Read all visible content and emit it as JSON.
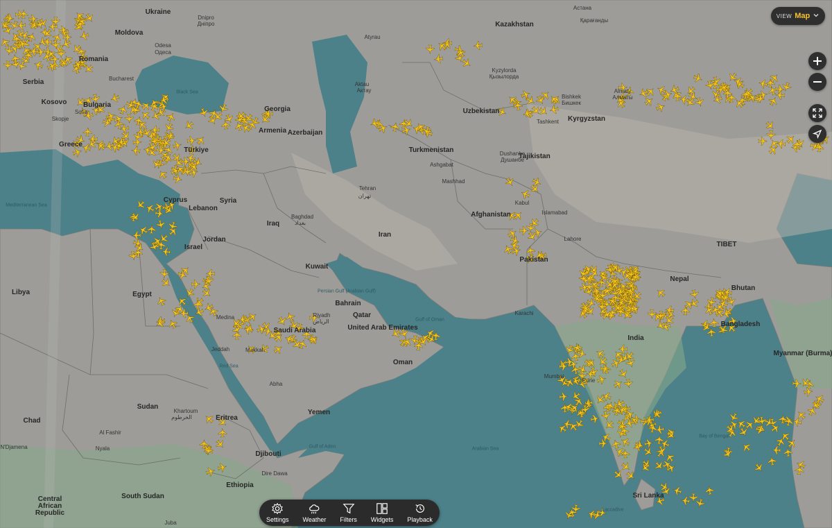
{
  "view": {
    "label": "VIEW",
    "mode": "Map"
  },
  "toolbar": [
    {
      "label": "Settings"
    },
    {
      "label": "Weather"
    },
    {
      "label": "Filters"
    },
    {
      "label": "Widgets"
    },
    {
      "label": "Playback"
    }
  ],
  "labels": {
    "countries": [
      "Ukraine",
      "Moldova",
      "Romania",
      "Serbia",
      "Bulgaria",
      "Kosovo",
      "Greece",
      "Georgia",
      "Armenia",
      "Azerbaijan",
      "Türkiye",
      "Cyprus",
      "Syria",
      "Lebanon",
      "Iraq",
      "Israel",
      "Jordan",
      "Libya",
      "Egypt",
      "Kuwait",
      "Iran",
      "Kazakhstan",
      "Uzbekistan",
      "Turkmenistan",
      "Tajikistan",
      "Kyrgyzstan",
      "Afghanistan",
      "Pakistan",
      "India",
      "Nepal",
      "Bhutan",
      "Bangladesh",
      "Myanmar (Burma)",
      "Saudi Arabia",
      "Bahrain",
      "Qatar",
      "United Arab Emirates",
      "Oman",
      "Yemen",
      "Sudan",
      "Chad",
      "Eritrea",
      "Djibouti",
      "Ethiopia",
      "South Sudan",
      "Central African Republic",
      "Sri Lanka",
      "TIBET"
    ],
    "cities": [
      "Odesa",
      "Одеса",
      "Dnipro",
      "Дніпро",
      "Atyrau",
      "Астана",
      "Қарағанды",
      "Aktau",
      "Актау",
      "Kyzylorda",
      "Қызылорда",
      "Bishkek",
      "Бишкек",
      "Almaty",
      "Алматы",
      "Tashkent",
      "Dushanbe",
      "Душанбе",
      "Ashgabat",
      "Mashhad",
      "Tehran",
      "تهران",
      "Baghdad",
      "بغداد",
      "Kabul",
      "Islamabad",
      "Lahore",
      "Karachi",
      "Riyadh",
      "الرياض",
      "Medina",
      "Jeddah",
      "Makkah",
      "Abha",
      "Khartoum",
      "الخرطوم",
      "Al Fashir",
      "Nyala",
      "N'Djamena",
      "Juba",
      "Mumbai",
      "Pune",
      "Dire Dawa",
      "Bucharest",
      "Sofia",
      "Skopje"
    ],
    "water": [
      "Black Sea",
      "Mediterranean Sea",
      "Red Sea",
      "Persian Gulf (Arabian Gulf)",
      "Gulf of Oman",
      "Arabian Sea",
      "Gulf of Aden",
      "Bay of Bengal",
      "Laccadive"
    ]
  },
  "colors": {
    "land": "#9a9a98",
    "water": "#4c8189",
    "plane": "#f5c51e",
    "ui_dark": "#2d2d2d",
    "accent": "#f2c230"
  },
  "icons": [
    "settings-gear-icon",
    "weather-icon",
    "filter-icon",
    "widgets-icon",
    "playback-icon",
    "zoom-in-icon",
    "zoom-out-icon",
    "fullscreen-icon",
    "locate-icon",
    "chevron-down-icon",
    "plane-icon"
  ]
}
